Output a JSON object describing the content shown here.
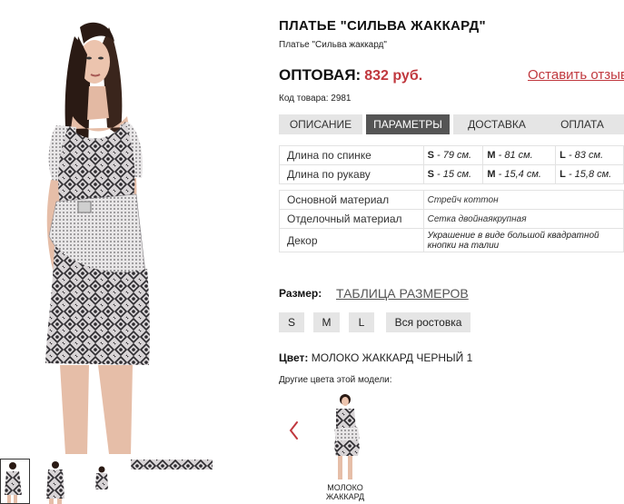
{
  "product": {
    "title": "ПЛАТЬЕ \"СИЛЬВА ЖАККАРД\"",
    "subtitle": "Платье \"Сильва жаккард\"",
    "price_label": "ОПТОВАЯ:",
    "price_value": "832 руб.",
    "review_link": "Оставить отзыв",
    "sku": "Код товара: 2981"
  },
  "tabs": [
    {
      "label": "ОПИСАНИЕ",
      "active": false
    },
    {
      "label": "ПАРАМЕТРЫ",
      "active": true
    },
    {
      "label": "ДОСТАВКА",
      "active": false
    },
    {
      "label": "ОПЛАТА",
      "active": false
    }
  ],
  "params": {
    "measurements": [
      {
        "label": "Длина по спинке",
        "s": "S",
        "s_val": " - 79 см.",
        "m": "M",
        "m_val": " - 81 см.",
        "l": "L",
        "l_val": " - 83 см."
      },
      {
        "label": "Длина по рукаву",
        "s": "S",
        "s_val": " - 15 см.",
        "m": "M",
        "m_val": " - 15,4 см.",
        "l": "L",
        "l_val": " - 15,8 см."
      }
    ],
    "materials": [
      {
        "label": "Основной материал",
        "value": "Стрейч коттон"
      },
      {
        "label": "Отделочный материал",
        "value": "Сетка двойнаякрупная"
      },
      {
        "label": "Декор",
        "value": "Украшение в виде большой квадратной кнопки на талии"
      }
    ]
  },
  "sizes": {
    "label": "Размер:",
    "table_link": "ТАБЛИЦА РАЗМЕРОВ",
    "options": [
      "S",
      "M",
      "L",
      "Вся ростовка"
    ]
  },
  "color": {
    "label": "Цвет:",
    "value": "МОЛОКО ЖАККАРД ЧЕРНЫЙ 1",
    "other_label": "Другие цвета этой модели:",
    "variant_caption": "МОЛОКО ЖАККАРД"
  },
  "colors": {
    "accent": "#c0383e",
    "tab_active": "#555555",
    "tab_bg": "#e5e5e5"
  },
  "icons": {
    "prev": "chevron-left-icon"
  }
}
